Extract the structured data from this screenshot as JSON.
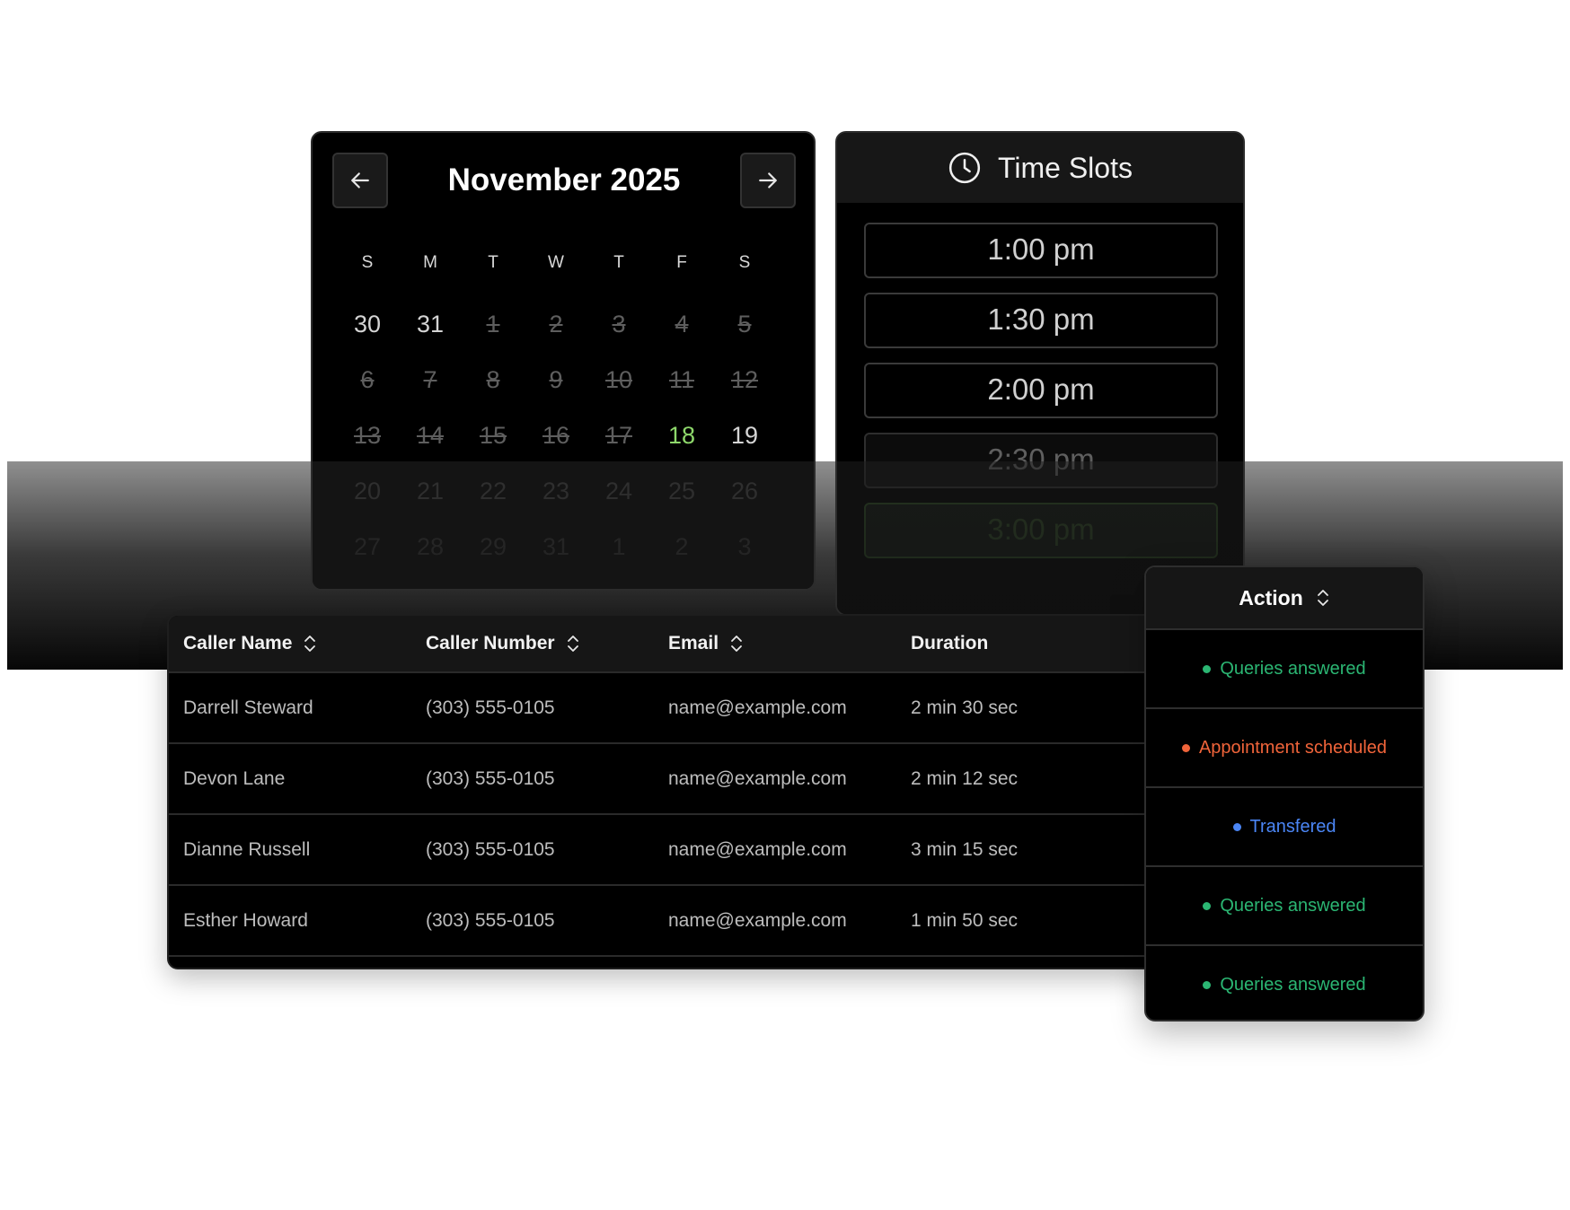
{
  "colors": {
    "queries": "#2bb673",
    "appointment": "#f0643a",
    "transferred": "#4b86f5",
    "today": "#8ed86b"
  },
  "calendar": {
    "title": "November 2025",
    "prev_icon": "arrow-left-icon",
    "next_icon": "arrow-right-icon",
    "weekdays": [
      "S",
      "M",
      "T",
      "W",
      "T",
      "F",
      "S"
    ],
    "days": [
      {
        "label": "30",
        "state": "normal"
      },
      {
        "label": "31",
        "state": "normal"
      },
      {
        "label": "1",
        "state": "struck"
      },
      {
        "label": "2",
        "state": "struck"
      },
      {
        "label": "3",
        "state": "struck"
      },
      {
        "label": "4",
        "state": "struck"
      },
      {
        "label": "5",
        "state": "struck"
      },
      {
        "label": "6",
        "state": "struck"
      },
      {
        "label": "7",
        "state": "struck"
      },
      {
        "label": "8",
        "state": "struck"
      },
      {
        "label": "9",
        "state": "struck"
      },
      {
        "label": "10",
        "state": "struck"
      },
      {
        "label": "11",
        "state": "struck"
      },
      {
        "label": "12",
        "state": "struck"
      },
      {
        "label": "13",
        "state": "struck"
      },
      {
        "label": "14",
        "state": "struck"
      },
      {
        "label": "15",
        "state": "struck"
      },
      {
        "label": "16",
        "state": "struck"
      },
      {
        "label": "17",
        "state": "struck"
      },
      {
        "label": "18",
        "state": "today"
      },
      {
        "label": "19",
        "state": "normal"
      },
      {
        "label": "20",
        "state": "fade"
      },
      {
        "label": "21",
        "state": "fade"
      },
      {
        "label": "22",
        "state": "fade"
      },
      {
        "label": "23",
        "state": "fade"
      },
      {
        "label": "24",
        "state": "fade"
      },
      {
        "label": "25",
        "state": "fade"
      },
      {
        "label": "26",
        "state": "fade"
      },
      {
        "label": "27",
        "state": "fade2"
      },
      {
        "label": "28",
        "state": "fade2"
      },
      {
        "label": "29",
        "state": "fade2"
      },
      {
        "label": "31",
        "state": "fade2"
      },
      {
        "label": "1",
        "state": "fade2"
      },
      {
        "label": "2",
        "state": "fade2"
      },
      {
        "label": "3",
        "state": "fade2"
      }
    ]
  },
  "time_slots": {
    "title": "Time Slots",
    "icon": "clock-icon",
    "slots": [
      {
        "label": "1:00 pm",
        "state": "normal"
      },
      {
        "label": "1:30 pm",
        "state": "normal"
      },
      {
        "label": "2:00 pm",
        "state": "normal"
      },
      {
        "label": "2:30 pm",
        "state": "dim"
      },
      {
        "label": "3:00 pm",
        "state": "green"
      }
    ]
  },
  "table": {
    "columns": [
      {
        "label": "Caller Name",
        "sortable": true
      },
      {
        "label": "Caller Number",
        "sortable": true
      },
      {
        "label": "Email",
        "sortable": true
      },
      {
        "label": "Duration",
        "sortable": false
      }
    ],
    "rows": [
      [
        "Darrell Steward",
        "(303) 555-0105",
        "name@example.com",
        "2 min 30 sec"
      ],
      [
        "Devon Lane",
        "(303) 555-0105",
        "name@example.com",
        "2 min 12 sec"
      ],
      [
        "Dianne Russell",
        "(303) 555-0105",
        "name@example.com",
        "3 min 15 sec"
      ],
      [
        "Esther Howard",
        "(303) 555-0105",
        "name@example.com",
        "1 min 50 sec"
      ]
    ]
  },
  "action": {
    "title": "Action",
    "items": [
      {
        "label": "Queries answered",
        "color_key": "queries"
      },
      {
        "label": "Appointment scheduled",
        "color_key": "appointment"
      },
      {
        "label": "Transfered",
        "color_key": "transferred"
      },
      {
        "label": "Queries answered",
        "color_key": "queries"
      },
      {
        "label": "Queries answered",
        "color_key": "queries"
      }
    ]
  }
}
